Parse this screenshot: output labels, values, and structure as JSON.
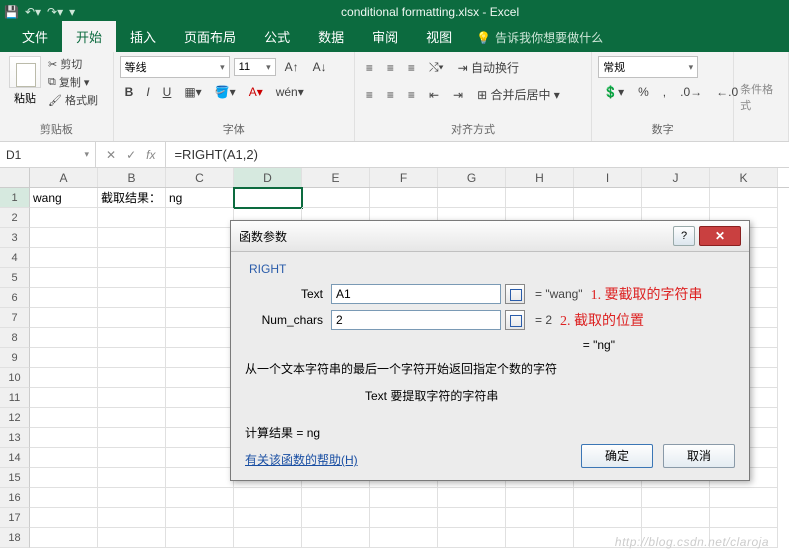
{
  "title": "conditional formatting.xlsx - Excel",
  "tabs": {
    "file": "文件",
    "home": "开始",
    "insert": "插入",
    "layout": "页面布局",
    "formulas": "公式",
    "data": "数据",
    "review": "审阅",
    "view": "视图"
  },
  "tell_me": "告诉我你想要做什么",
  "ribbon": {
    "clipboard": {
      "paste": "粘贴",
      "cut": "剪切",
      "copy": "复制",
      "format_painter": "格式刷",
      "label": "剪贴板"
    },
    "font": {
      "name": "等线",
      "size": "11",
      "grow": "A",
      "shrink": "A",
      "bold": "B",
      "italic": "I",
      "underline": "U",
      "label": "字体"
    },
    "align": {
      "wrap": "自动换行",
      "merge": "合并后居中",
      "label": "对齐方式"
    },
    "number": {
      "format": "常规",
      "label": "数字"
    },
    "styles": {
      "cond": "条件格式"
    }
  },
  "name_box": "D1",
  "formula": "=RIGHT(A1,2)",
  "columns": [
    "A",
    "B",
    "C",
    "D",
    "E",
    "F",
    "G",
    "H",
    "I",
    "J",
    "K"
  ],
  "row_count": 18,
  "cells": {
    "A1": "wang",
    "B1": "截取结果：",
    "C1": "ng"
  },
  "active_cell": "D1",
  "dialog": {
    "title": "函数参数",
    "func": "RIGHT",
    "args": {
      "text": {
        "label": "Text",
        "value": "A1",
        "eval": "= \"wang\"",
        "annot": "1. 要截取的字符串"
      },
      "num": {
        "label": "Num_chars",
        "value": "2",
        "eval": "= 2",
        "annot": "2. 截取的位置"
      }
    },
    "preview": "= \"ng\"",
    "desc": "从一个文本字符串的最后一个字符开始返回指定个数的字符",
    "arg_desc": "Text  要提取字符的字符串",
    "calc_label": "计算结果 = ",
    "calc_value": "ng",
    "help": "有关该函数的帮助(H)",
    "ok": "确定",
    "cancel": "取消"
  },
  "watermark": "http://blog.csdn.net/claroja"
}
